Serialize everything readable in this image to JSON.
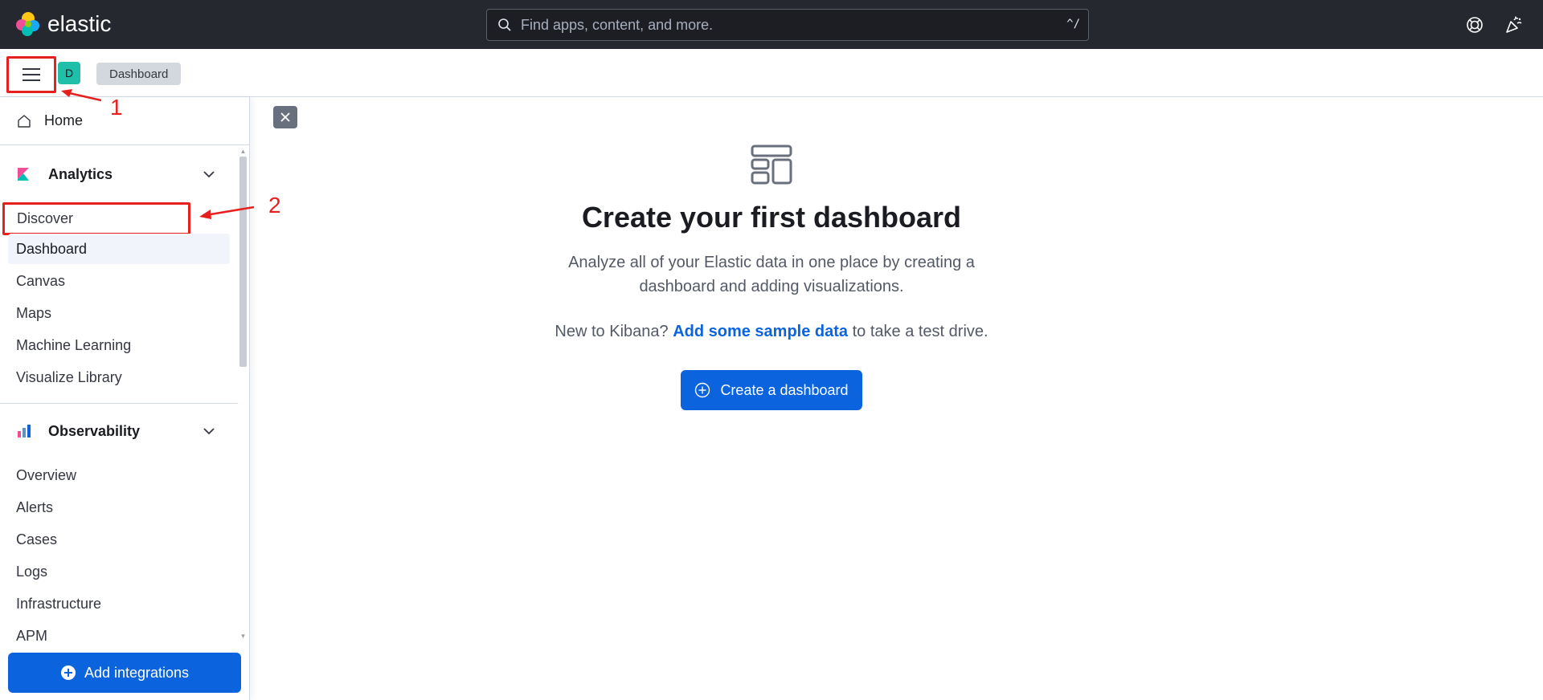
{
  "header": {
    "brand": "elastic",
    "search_placeholder": "Find apps, content, and more.",
    "search_shortcut": "^/"
  },
  "subbar": {
    "space_initial": "D",
    "breadcrumb": "Dashboard"
  },
  "sidebar": {
    "home_label": "Home",
    "groups": [
      {
        "label": "Analytics",
        "items": [
          "Discover",
          "Dashboard",
          "Canvas",
          "Maps",
          "Machine Learning",
          "Visualize Library"
        ]
      },
      {
        "label": "Observability",
        "items": [
          "Overview",
          "Alerts",
          "Cases",
          "Logs",
          "Infrastructure",
          "APM"
        ]
      }
    ],
    "footer_button": "Add integrations"
  },
  "annotations": {
    "step1": "1",
    "step2": "2"
  },
  "main": {
    "title": "Create your first dashboard",
    "body": "Analyze all of your Elastic data in one place by creating a dashboard and adding visualizations.",
    "hint_prefix": "New to Kibana?",
    "hint_link": "Add some sample data",
    "hint_suffix": "to take a test drive.",
    "create_button": "Create a dashboard"
  },
  "colors": {
    "header_bg": "#25282f",
    "primary": "#0b64dd",
    "annotation": "#e6201f",
    "space_badge": "#20bfaa"
  }
}
